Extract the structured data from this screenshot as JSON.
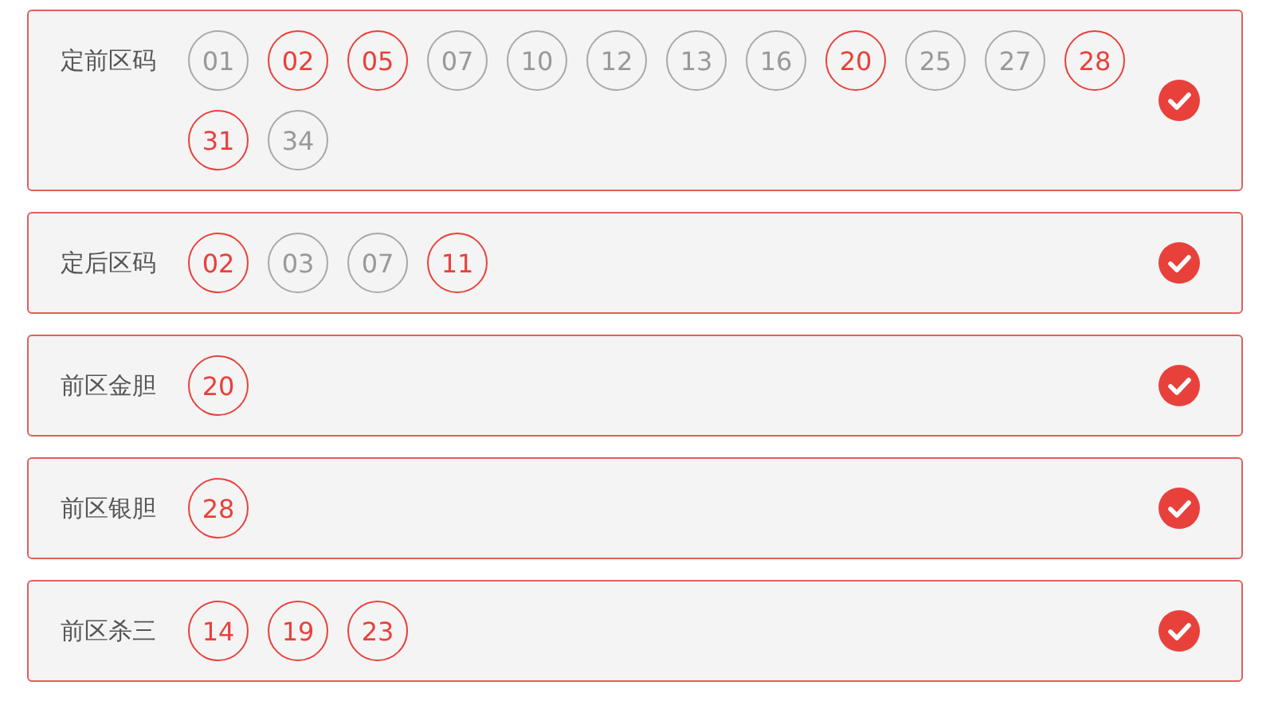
{
  "rows": [
    {
      "label": "定前区码",
      "checked": true,
      "balls": [
        {
          "number": "01",
          "selected": false
        },
        {
          "number": "02",
          "selected": true
        },
        {
          "number": "05",
          "selected": true
        },
        {
          "number": "07",
          "selected": false
        },
        {
          "number": "10",
          "selected": false
        },
        {
          "number": "12",
          "selected": false
        },
        {
          "number": "13",
          "selected": false
        },
        {
          "number": "16",
          "selected": false
        },
        {
          "number": "20",
          "selected": true
        },
        {
          "number": "25",
          "selected": false
        },
        {
          "number": "27",
          "selected": false
        },
        {
          "number": "28",
          "selected": true
        },
        {
          "number": "31",
          "selected": true
        },
        {
          "number": "34",
          "selected": false
        }
      ]
    },
    {
      "label": "定后区码",
      "checked": true,
      "balls": [
        {
          "number": "02",
          "selected": true
        },
        {
          "number": "03",
          "selected": false
        },
        {
          "number": "07",
          "selected": false
        },
        {
          "number": "11",
          "selected": true
        }
      ]
    },
    {
      "label": "前区金胆",
      "checked": true,
      "balls": [
        {
          "number": "20",
          "selected": true
        }
      ]
    },
    {
      "label": "前区银胆",
      "checked": true,
      "balls": [
        {
          "number": "28",
          "selected": true
        }
      ]
    },
    {
      "label": "前区杀三",
      "checked": true,
      "balls": [
        {
          "number": "14",
          "selected": true
        },
        {
          "number": "19",
          "selected": true
        },
        {
          "number": "23",
          "selected": true
        }
      ]
    }
  ]
}
